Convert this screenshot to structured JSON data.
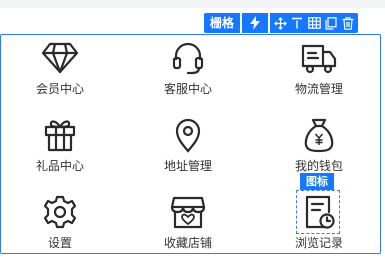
{
  "toolbar": {
    "grid_label": "栅格",
    "bolt_icon": "lightning-icon",
    "actions": [
      "move-icon",
      "align-top-icon",
      "table-icon",
      "copy-icon",
      "delete-icon"
    ]
  },
  "selected": {
    "tag_label": "图标"
  },
  "items": [
    {
      "label": "会员中心",
      "icon": "diamond-icon"
    },
    {
      "label": "客服中心",
      "icon": "headset-icon"
    },
    {
      "label": "物流管理",
      "icon": "truck-icon"
    },
    {
      "label": "礼品中心",
      "icon": "gift-icon"
    },
    {
      "label": "地址管理",
      "icon": "location-pin-icon"
    },
    {
      "label": "我的钱包",
      "icon": "money-bag-icon"
    },
    {
      "label": "设置",
      "icon": "gear-icon"
    },
    {
      "label": "收藏店铺",
      "icon": "store-heart-icon"
    },
    {
      "label": "浏览记录",
      "icon": "history-document-icon"
    }
  ],
  "colors": {
    "accent": "#1677ff",
    "icon": "#2b2b2b",
    "text": "#333333"
  }
}
